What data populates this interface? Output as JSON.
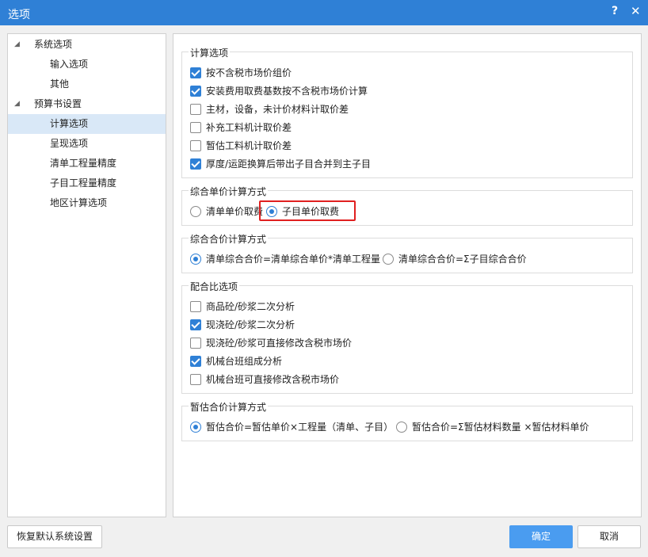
{
  "window": {
    "title": "选项",
    "help": "?",
    "close": "✕"
  },
  "tree": [
    {
      "label": "系统选项"
    },
    {
      "label": "输入选项"
    },
    {
      "label": "其他"
    },
    {
      "label": "预算书设置"
    },
    {
      "label": "计算选项"
    },
    {
      "label": "呈现选项"
    },
    {
      "label": "清单工程量精度"
    },
    {
      "label": "子目工程量精度"
    },
    {
      "label": "地区计算选项"
    }
  ],
  "groups": {
    "calc": {
      "title": "计算选项",
      "items": [
        {
          "label": "按不含税市场价组价",
          "checked": true
        },
        {
          "label": "安装费用取费基数按不含税市场价计算",
          "checked": true
        },
        {
          "label": "主材，设备，未计价材料计取价差",
          "checked": false
        },
        {
          "label": "补充工料机计取价差",
          "checked": false
        },
        {
          "label": "暂估工料机计取价差",
          "checked": false
        },
        {
          "label": "厚度/运距换算后带出子目合并到主子目",
          "checked": true
        }
      ]
    },
    "unit_price": {
      "title": "综合单价计算方式",
      "options": [
        {
          "label": "清单单价取费",
          "checked": false
        },
        {
          "label": "子目单价取费",
          "checked": true
        }
      ]
    },
    "total_price": {
      "title": "综合合价计算方式",
      "options": [
        {
          "label": "清单综合合价=清单综合单价*清单工程量",
          "checked": true
        },
        {
          "label": "清单综合合价=Σ子目综合合价",
          "checked": false
        }
      ]
    },
    "mix": {
      "title": "配合比选项",
      "items": [
        {
          "label": "商品砼/砂浆二次分析",
          "checked": false
        },
        {
          "label": "现浇砼/砂浆二次分析",
          "checked": true
        },
        {
          "label": "现浇砼/砂浆可直接修改含税市场价",
          "checked": false
        },
        {
          "label": "机械台班组成分析",
          "checked": true
        },
        {
          "label": "机械台班可直接修改含税市场价",
          "checked": false
        }
      ]
    },
    "provisional": {
      "title": "暂估合价计算方式",
      "options": [
        {
          "label": "暂估合价=暂估单价×工程量（清单、子目）",
          "checked": true
        },
        {
          "label": "暂估合价=Σ暂估材料数量 ×暂估材料单价",
          "checked": false
        }
      ]
    }
  },
  "buttons": {
    "restore": "恢复默认系统设置",
    "ok": "确定",
    "cancel": "取消"
  }
}
